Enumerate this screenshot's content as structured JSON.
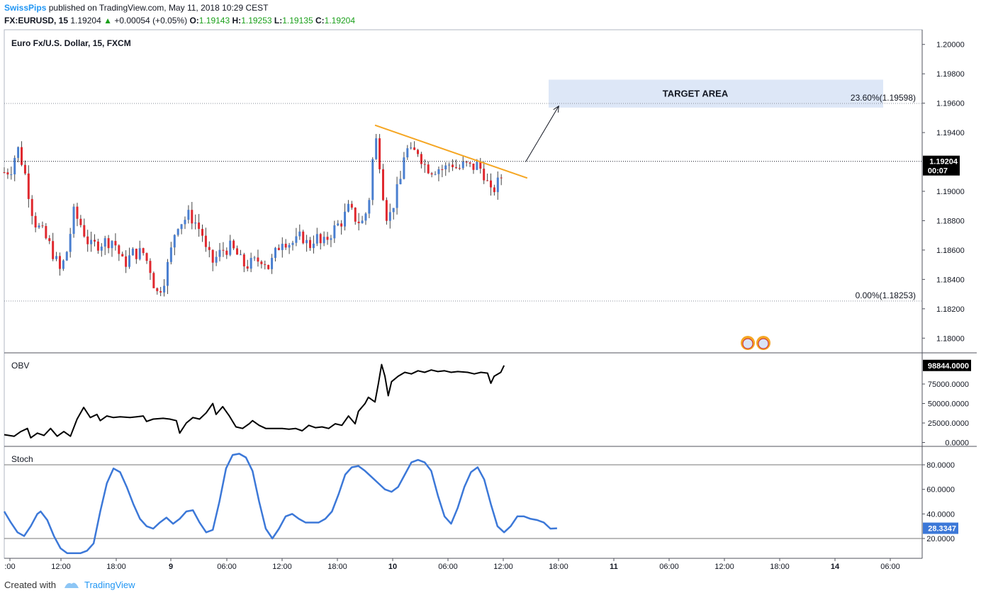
{
  "header": {
    "author": "SwissPips",
    "published_text": "published on TradingView.com, May 11, 2018 10:29 CEST",
    "symbol": "FX:EURUSD, 15",
    "last": "1.19204",
    "change": "+0.00054 (+0.05%)",
    "o_label": "O:",
    "o": "1.19143",
    "h_label": "H:",
    "h": "1.19253",
    "l_label": "L:",
    "l": "1.19135",
    "c_label": "C:",
    "c": "1.19204"
  },
  "footer": {
    "created_with": "Created with",
    "brand": "TradingView"
  },
  "colors": {
    "up": "#4a7fd0",
    "down": "#e0282e",
    "trendline": "#f5a623",
    "target": "#dde7f7",
    "obv": "#000000",
    "stoch": "#3c78d8"
  },
  "chart_data": [
    {
      "type": "candlestick",
      "title": "Euro Fx/U.S. Dollar, 15, FXCM",
      "ylim": [
        1.179,
        1.201
      ],
      "y_ticks": [
        "1.20000",
        "1.19800",
        "1.19600",
        "1.19400",
        "1.19000",
        "1.18800",
        "1.18600",
        "1.18400",
        "1.18200",
        "1.18000"
      ],
      "x_ticks": [
        ":00",
        "12:00",
        "18:00",
        "9",
        "06:00",
        "12:00",
        "18:00",
        "10",
        "06:00",
        "12:00",
        "18:00",
        "11",
        "06:00",
        "12:00",
        "18:00",
        "14",
        "06:00"
      ],
      "last_price": "1.19204",
      "countdown": "00:07",
      "price_path": [
        [
          0,
          1.1913
        ],
        [
          0.02,
          1.1915
        ],
        [
          0.04,
          1.193
        ],
        [
          0.06,
          1.1915
        ],
        [
          0.09,
          1.188
        ],
        [
          0.12,
          1.187
        ],
        [
          0.14,
          1.1862
        ],
        [
          0.17,
          1.1845
        ],
        [
          0.19,
          1.186
        ],
        [
          0.21,
          1.1885
        ],
        [
          0.23,
          1.1878
        ],
        [
          0.26,
          1.1862
        ],
        [
          0.29,
          1.1865
        ],
        [
          0.33,
          1.1867
        ],
        [
          0.36,
          1.185
        ],
        [
          0.39,
          1.1858
        ],
        [
          0.42,
          1.1858
        ],
        [
          0.44,
          1.1848
        ],
        [
          0.46,
          1.183
        ],
        [
          0.48,
          1.1838
        ],
        [
          0.5,
          1.1855
        ],
        [
          0.52,
          1.1878
        ],
        [
          0.54,
          1.188
        ],
        [
          0.56,
          1.1884
        ],
        [
          0.58,
          1.1878
        ],
        [
          0.6,
          1.187
        ],
        [
          0.61,
          1.1858
        ],
        [
          0.63,
          1.1852
        ],
        [
          0.66,
          1.186
        ],
        [
          0.68,
          1.1862
        ],
        [
          0.7,
          1.1858
        ],
        [
          0.72,
          1.185
        ],
        [
          0.74,
          1.185
        ],
        [
          0.76,
          1.1852
        ],
        [
          0.78,
          1.1855
        ],
        [
          0.8,
          1.1848
        ],
        [
          0.82,
          1.1858
        ],
        [
          0.84,
          1.1868
        ],
        [
          0.86,
          1.1865
        ],
        [
          0.88,
          1.1865
        ],
        [
          0.9,
          1.187
        ],
        [
          0.92,
          1.1862
        ],
        [
          0.94,
          1.187
        ],
        [
          0.96,
          1.1862
        ],
        [
          0.98,
          1.187
        ],
        [
          1.0,
          1.1875
        ],
        [
          1.02,
          1.188
        ],
        [
          1.04,
          1.1888
        ],
        [
          1.06,
          1.1882
        ],
        [
          1.08,
          1.1878
        ],
        [
          1.1,
          1.189
        ],
        [
          1.12,
          1.1938
        ],
        [
          1.13,
          1.1928
        ],
        [
          1.15,
          1.1888
        ],
        [
          1.16,
          1.188
        ],
        [
          1.18,
          1.1895
        ],
        [
          1.2,
          1.191
        ],
        [
          1.21,
          1.193
        ],
        [
          1.23,
          1.1925
        ],
        [
          1.25,
          1.1928
        ],
        [
          1.27,
          1.1918
        ],
        [
          1.29,
          1.1915
        ],
        [
          1.31,
          1.1916
        ],
        [
          1.33,
          1.1915
        ],
        [
          1.35,
          1.192
        ],
        [
          1.37,
          1.1915
        ],
        [
          1.39,
          1.1918
        ],
        [
          1.41,
          1.1916
        ],
        [
          1.43,
          1.1918
        ],
        [
          1.45,
          1.1912
        ],
        [
          1.47,
          1.1898
        ],
        [
          1.48,
          1.1902
        ],
        [
          1.5,
          1.1908
        ],
        [
          1.51,
          1.192
        ]
      ],
      "fib_levels": [
        {
          "label": "23.60%(1.19598)",
          "value": 1.19598
        },
        {
          "label": "0.00%(1.18253)",
          "value": 1.18253
        }
      ],
      "annotations": {
        "target_label": "TARGET AREA",
        "target_range": [
          1.1957,
          1.1976
        ],
        "trendline": [
          [
            1.12,
            1.1945
          ],
          [
            1.58,
            1.1909
          ]
        ],
        "arrow": [
          [
            1.575,
            1.192
          ],
          [
            1.675,
            1.1958
          ]
        ]
      }
    },
    {
      "type": "line",
      "title": "OBV",
      "ylim": [
        -5000,
        115000
      ],
      "y_ticks": [
        "75000.0000",
        "50000.0000",
        "25000.0000",
        "0.0000"
      ],
      "last_value": "98844.0000",
      "points": [
        [
          0,
          10000
        ],
        [
          0.03,
          8000
        ],
        [
          0.05,
          14000
        ],
        [
          0.07,
          18000
        ],
        [
          0.08,
          6000
        ],
        [
          0.1,
          12000
        ],
        [
          0.12,
          9000
        ],
        [
          0.14,
          18000
        ],
        [
          0.16,
          8000
        ],
        [
          0.18,
          14000
        ],
        [
          0.2,
          8000
        ],
        [
          0.22,
          30000
        ],
        [
          0.24,
          45000
        ],
        [
          0.26,
          32000
        ],
        [
          0.28,
          36000
        ],
        [
          0.29,
          28000
        ],
        [
          0.31,
          34000
        ],
        [
          0.33,
          32000
        ],
        [
          0.35,
          33000
        ],
        [
          0.38,
          32000
        ],
        [
          0.4,
          33000
        ],
        [
          0.42,
          34000
        ],
        [
          0.43,
          27000
        ],
        [
          0.45,
          30000
        ],
        [
          0.48,
          31000
        ],
        [
          0.5,
          30000
        ],
        [
          0.52,
          28000
        ],
        [
          0.53,
          12000
        ],
        [
          0.55,
          25000
        ],
        [
          0.57,
          32000
        ],
        [
          0.59,
          30000
        ],
        [
          0.61,
          38000
        ],
        [
          0.63,
          50000
        ],
        [
          0.64,
          36000
        ],
        [
          0.66,
          46000
        ],
        [
          0.68,
          34000
        ],
        [
          0.7,
          20000
        ],
        [
          0.72,
          18000
        ],
        [
          0.74,
          24000
        ],
        [
          0.75,
          28000
        ],
        [
          0.77,
          22000
        ],
        [
          0.79,
          18000
        ],
        [
          0.82,
          18000
        ],
        [
          0.84,
          18000
        ],
        [
          0.86,
          17000
        ],
        [
          0.88,
          18000
        ],
        [
          0.9,
          15000
        ],
        [
          0.92,
          22000
        ],
        [
          0.94,
          19000
        ],
        [
          0.96,
          20000
        ],
        [
          0.98,
          18000
        ],
        [
          1.0,
          24000
        ],
        [
          1.02,
          22000
        ],
        [
          1.04,
          34000
        ],
        [
          1.06,
          24000
        ],
        [
          1.07,
          40000
        ],
        [
          1.09,
          50000
        ],
        [
          1.1,
          58000
        ],
        [
          1.12,
          52000
        ],
        [
          1.13,
          75000
        ],
        [
          1.14,
          100000
        ],
        [
          1.15,
          85000
        ],
        [
          1.16,
          60000
        ],
        [
          1.17,
          78000
        ],
        [
          1.19,
          85000
        ],
        [
          1.21,
          90000
        ],
        [
          1.23,
          88000
        ],
        [
          1.25,
          92000
        ],
        [
          1.27,
          90000
        ],
        [
          1.29,
          93000
        ],
        [
          1.31,
          91000
        ],
        [
          1.33,
          92000
        ],
        [
          1.35,
          90000
        ],
        [
          1.37,
          91000
        ],
        [
          1.4,
          90000
        ],
        [
          1.42,
          88000
        ],
        [
          1.44,
          90000
        ],
        [
          1.46,
          89000
        ],
        [
          1.47,
          76000
        ],
        [
          1.48,
          85000
        ],
        [
          1.5,
          90000
        ],
        [
          1.51,
          98844
        ]
      ]
    },
    {
      "type": "line",
      "title": "Stoch",
      "ylim": [
        0,
        100
      ],
      "y_ticks": [
        "80.0000",
        "60.0000",
        "40.0000",
        "20.0000"
      ],
      "bands": [
        80,
        20
      ],
      "last_value": "28.3347",
      "points": [
        [
          0,
          42
        ],
        [
          0.02,
          33
        ],
        [
          0.04,
          25
        ],
        [
          0.06,
          22
        ],
        [
          0.08,
          30
        ],
        [
          0.1,
          40
        ],
        [
          0.11,
          42
        ],
        [
          0.13,
          35
        ],
        [
          0.15,
          22
        ],
        [
          0.17,
          12
        ],
        [
          0.19,
          8
        ],
        [
          0.21,
          8
        ],
        [
          0.23,
          8
        ],
        [
          0.25,
          10
        ],
        [
          0.27,
          16
        ],
        [
          0.29,
          42
        ],
        [
          0.31,
          65
        ],
        [
          0.33,
          77
        ],
        [
          0.35,
          74
        ],
        [
          0.37,
          62
        ],
        [
          0.39,
          48
        ],
        [
          0.41,
          36
        ],
        [
          0.43,
          30
        ],
        [
          0.45,
          28
        ],
        [
          0.47,
          33
        ],
        [
          0.49,
          37
        ],
        [
          0.51,
          32
        ],
        [
          0.53,
          36
        ],
        [
          0.55,
          42
        ],
        [
          0.57,
          43
        ],
        [
          0.59,
          33
        ],
        [
          0.61,
          25
        ],
        [
          0.63,
          27
        ],
        [
          0.65,
          50
        ],
        [
          0.67,
          77
        ],
        [
          0.69,
          88
        ],
        [
          0.71,
          89
        ],
        [
          0.73,
          86
        ],
        [
          0.75,
          75
        ],
        [
          0.77,
          50
        ],
        [
          0.79,
          28
        ],
        [
          0.81,
          20
        ],
        [
          0.83,
          28
        ],
        [
          0.85,
          38
        ],
        [
          0.87,
          40
        ],
        [
          0.89,
          36
        ],
        [
          0.91,
          33
        ],
        [
          0.93,
          33
        ],
        [
          0.95,
          33
        ],
        [
          0.97,
          36
        ],
        [
          0.99,
          42
        ],
        [
          1.01,
          56
        ],
        [
          1.03,
          72
        ],
        [
          1.05,
          78
        ],
        [
          1.07,
          79
        ],
        [
          1.09,
          75
        ],
        [
          1.11,
          70
        ],
        [
          1.13,
          65
        ],
        [
          1.15,
          60
        ],
        [
          1.17,
          58
        ],
        [
          1.19,
          62
        ],
        [
          1.21,
          72
        ],
        [
          1.23,
          82
        ],
        [
          1.25,
          84
        ],
        [
          1.27,
          82
        ],
        [
          1.29,
          75
        ],
        [
          1.31,
          55
        ],
        [
          1.33,
          38
        ],
        [
          1.35,
          32
        ],
        [
          1.37,
          45
        ],
        [
          1.39,
          62
        ],
        [
          1.41,
          74
        ],
        [
          1.43,
          78
        ],
        [
          1.45,
          68
        ],
        [
          1.47,
          48
        ],
        [
          1.49,
          30
        ],
        [
          1.51,
          25
        ],
        [
          1.53,
          30
        ],
        [
          1.55,
          38
        ],
        [
          1.57,
          38
        ],
        [
          1.59,
          36
        ],
        [
          1.61,
          35
        ],
        [
          1.63,
          33
        ],
        [
          1.65,
          28
        ],
        [
          1.67,
          28.3
        ]
      ]
    }
  ]
}
